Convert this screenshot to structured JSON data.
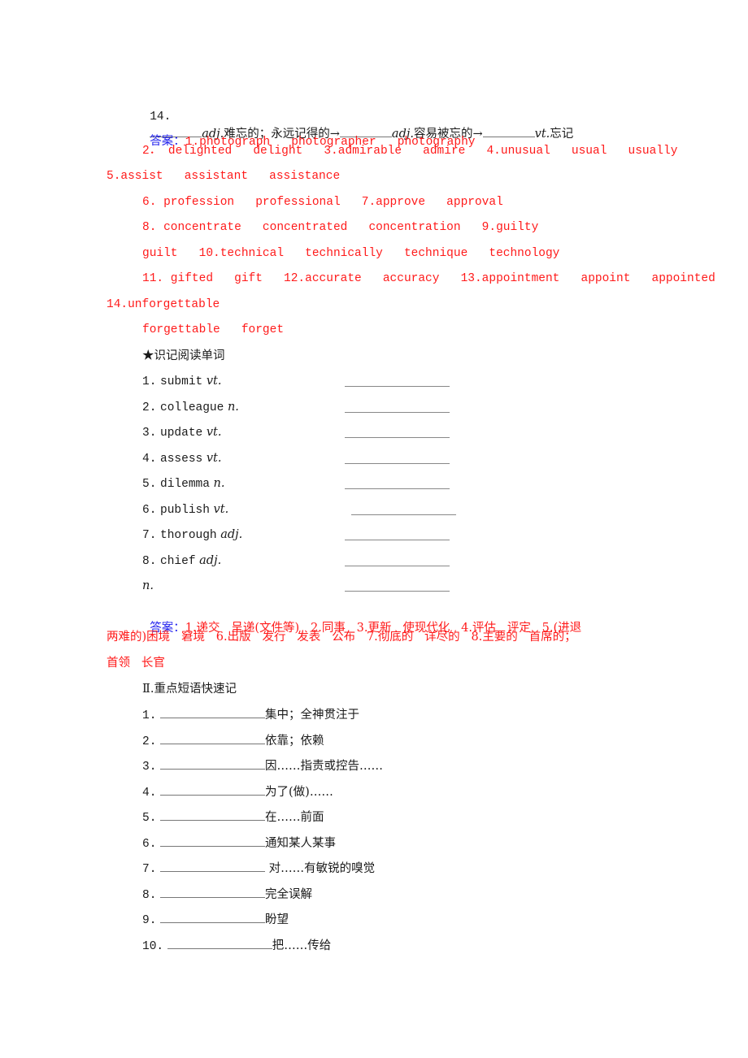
{
  "q14": {
    "num": "14.",
    "pos1": "adj.",
    "def1": "难忘的；永远记得的",
    "arrow": "→",
    "pos2": "adj.",
    "def2": "容易被忘的",
    "pos3": "vt.",
    "def3": "忘记"
  },
  "answers1": {
    "label": "答案：",
    "lines": [
      "1.photograph   photographer   photography",
      "2． delighted   delight   3.admirable   admire   4.unusual   usual   usually",
      "5.assist   assistant   assistance",
      "6. profession   professional   7.approve   approval",
      "8. concentrate   concentrated   concentration   9.guilty",
      "guilt   10.technical   technically   technique   technology",
      "11. gifted   gift   12.accurate   accuracy   13.appointment   appoint   appointed",
      "14.unforgettable",
      "forgettable   forget"
    ]
  },
  "reading": {
    "heading": "★识记阅读单词",
    "items": [
      {
        "num": "1.",
        "word": "submit",
        "pos": "vt."
      },
      {
        "num": "2.",
        "word": "colleague",
        "pos": "n."
      },
      {
        "num": "3.",
        "word": "update",
        "pos": "vt."
      },
      {
        "num": "4.",
        "word": "assess",
        "pos": "vt."
      },
      {
        "num": "5.",
        "word": "dilemma",
        "pos": "n."
      },
      {
        "num": "6.",
        "word": "publish",
        "pos": "vt."
      },
      {
        "num": "7.",
        "word": "thorough",
        "pos": "adj."
      },
      {
        "num": "8.",
        "word": "chief",
        "pos": "adj."
      },
      {
        "num": "",
        "word": "",
        "pos": "n."
      }
    ]
  },
  "answers2": {
    "label": "答案：",
    "lines": [
      "1.递交   呈递(文件等)   2.同事   3.更新   使现代化   4.评估   评定   5.(进退",
      "两难的)困境   窘境   6.出版   发行   发表   公布   7.彻底的   详尽的   8.主要的   首席的；",
      "首领   长官"
    ]
  },
  "phrases": {
    "heading": "Ⅱ.重点短语快速记",
    "items": [
      {
        "num": "1.",
        "meaning": "集中；全神贯注于"
      },
      {
        "num": "2.",
        "meaning": "依靠；依赖"
      },
      {
        "num": "3.",
        "meaning": "因……指责或控告……"
      },
      {
        "num": "4.",
        "meaning": "为了(做)……"
      },
      {
        "num": "5.",
        "meaning": "在……前面"
      },
      {
        "num": "6.",
        "meaning": "通知某人某事"
      },
      {
        "num": "7.",
        "meaning": " 对……有敏锐的嗅觉"
      },
      {
        "num": "8.",
        "meaning": "完全误解"
      },
      {
        "num": "9.",
        "meaning": "盼望"
      },
      {
        "num": "10.",
        "meaning": "把……传给"
      }
    ]
  },
  "colors": {
    "answer_label": "#2222ee",
    "answer_text": "#ff1a1a",
    "body_text": "#1a1a1a"
  }
}
